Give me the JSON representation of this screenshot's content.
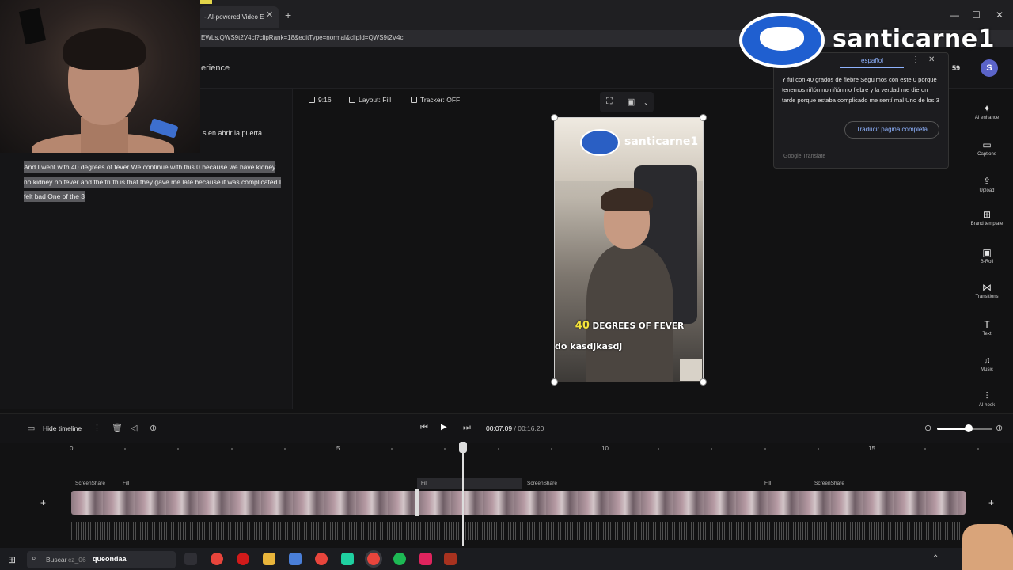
{
  "browser": {
    "tab_title": "- AI-powered Video E",
    "url": "EWLs.QWS9t2V4cl?clipRank=18&editType=normal&clipId=QWS9t2V4cl"
  },
  "header": {
    "title": "erience",
    "count": "59",
    "avatar_letter": "S"
  },
  "watermark": {
    "text": "santicarne1"
  },
  "transcript": {
    "line": "s en abrir la puerta.",
    "selected": "And I went with 40 degrees of fever We continue with this 0 because we have kidney no kidney no fever and the truth is that they gave me late because it was complicated I felt bad One of the 3"
  },
  "canvas_toolbar": {
    "aspect": "9:16",
    "layout": "Layout: Fill",
    "tracker": "Tracker: OFF"
  },
  "preview": {
    "brand": "santicarne1",
    "caption_highlight": "40",
    "caption_rest": "DEGREES OF FEVER",
    "caption_line2": "do kasdjkasdj"
  },
  "translate_popup": {
    "language": "español",
    "text": "Y fui con 40 grados de fiebre Seguimos con este 0 porque tenemos riñón no riñón no fiebre y la verdad me dieron tarde porque estaba complicado me sentí mal Uno de los 3",
    "button": "Traducir página completa",
    "footer": "Google Translate"
  },
  "right_tools": [
    {
      "icon": "ai-enhance-icon",
      "glyph": "✦",
      "label": "AI enhance"
    },
    {
      "icon": "captions-icon",
      "glyph": "▭",
      "label": "Captions"
    },
    {
      "icon": "upload-icon",
      "glyph": "⇪",
      "label": "Upload"
    },
    {
      "icon": "brand-template-icon",
      "glyph": "⊞",
      "label": "Brand template"
    },
    {
      "icon": "b-roll-icon",
      "glyph": "▣",
      "label": "B-Roll"
    },
    {
      "icon": "transitions-icon",
      "glyph": "⋈",
      "label": "Transitions"
    },
    {
      "icon": "text-icon",
      "glyph": "T",
      "label": "Text"
    },
    {
      "icon": "music-icon",
      "glyph": "♫",
      "label": "Music"
    },
    {
      "icon": "ai-hook-icon",
      "glyph": "⫶",
      "label": "AI hook"
    }
  ],
  "timeline": {
    "hide_label": "Hide timeline",
    "current_time": "00:07.09",
    "separator": "/",
    "duration": "00:16.20",
    "ruler": [
      "0",
      "5",
      "10",
      "15"
    ],
    "track_labels": [
      "ScreenShare",
      "Fill",
      "Fill",
      "ScreenShare",
      "Fill",
      "ScreenShare"
    ],
    "zoom_level": 0.57
  },
  "taskbar": {
    "search_placeholder": "Buscar",
    "search_user": "queondaa",
    "partial_text": "cz_06"
  },
  "colors": {
    "accent": "#8fb3ff",
    "avatar": "#5b64c9",
    "caption_highlight": "#f5e33b"
  }
}
